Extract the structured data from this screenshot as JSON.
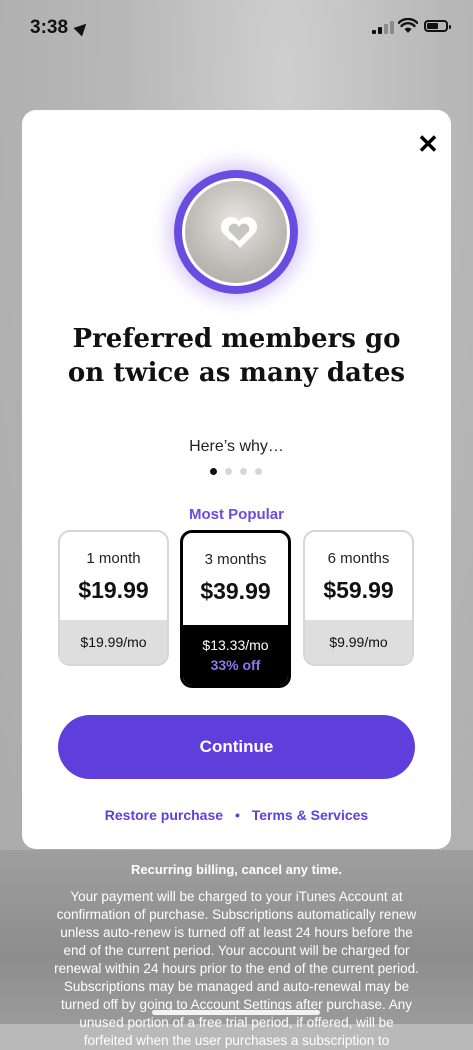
{
  "status_bar": {
    "time": "3:38"
  },
  "modal": {
    "close_icon": "close-icon",
    "headline": "Preferred members go on twice as many dates",
    "subhead": "Here’s why…",
    "pager": {
      "count": 4,
      "active": 0
    },
    "most_popular_label": "Most Popular",
    "plans": [
      {
        "term": "1 month",
        "price": "$19.99",
        "per_month": "$19.99/mo",
        "discount": "",
        "selected": false
      },
      {
        "term": "3 months",
        "price": "$39.99",
        "per_month": "$13.33/mo",
        "discount": "33% off",
        "selected": true
      },
      {
        "term": "6 months",
        "price": "$59.99",
        "per_month": "$9.99/mo",
        "discount": "",
        "selected": false
      }
    ],
    "continue_label": "Continue",
    "links": {
      "restore": "Restore purchase",
      "separator": "•",
      "terms": "Terms & Services"
    }
  },
  "footer": {
    "recurring": "Recurring billing, cancel any time.",
    "legal": "Your payment will be charged to your iTunes Account at confirmation of purchase. Subscriptions automatically renew unless auto-renew is turned off at least 24 hours before the end of the current period. Your account will be charged for renewal within 24 hours prior to the end of the current period. Subscriptions may be managed and auto-renewal may be turned off by going to Account Settings after purchase. Any unused portion of a free trial period, if offered, will be forfeited when the user purchases a subscription to"
  },
  "colors": {
    "accent": "#5f3fdc",
    "selected_border": "#000000",
    "discount": "#8c78f0"
  }
}
